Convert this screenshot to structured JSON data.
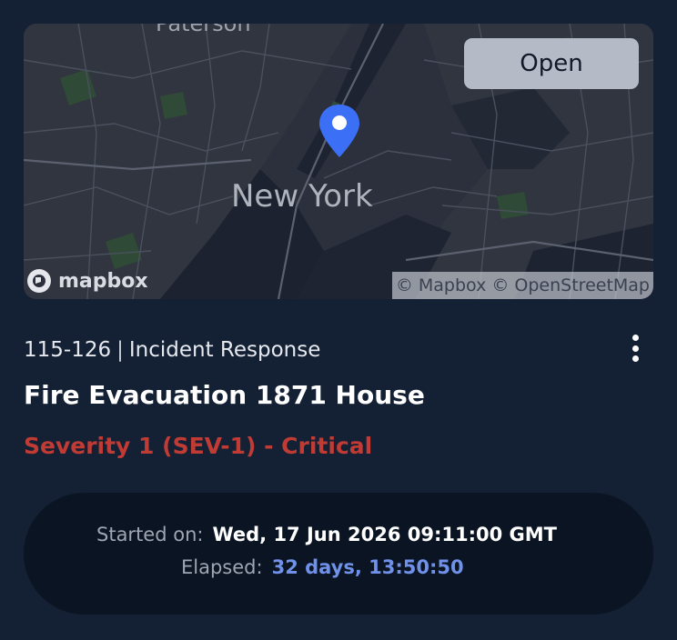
{
  "map": {
    "city_label": "New York",
    "town_label": "Paterson",
    "open_button_label": "Open",
    "logo_text": "mapbox",
    "attribution": "© Mapbox © OpenStreetMap",
    "pin_icon": "map-pin-icon",
    "pin_color": "#3b6ff5"
  },
  "incident": {
    "id": "115-126",
    "separator": "|",
    "type": "Incident Response",
    "title": "Fire Evacuation 1871 House",
    "severity": "Severity 1 (SEV-1) - Critical",
    "severity_color": "#c13b35"
  },
  "menu": {
    "icon": "more-vertical-icon"
  },
  "timing": {
    "started_label": "Started on:",
    "started_value": "Wed, 17 Jun 2026 09:11:00 GMT",
    "elapsed_label": "Elapsed:",
    "elapsed_value": "32 days, 13:50:50",
    "elapsed_color": "#6f91ea"
  }
}
